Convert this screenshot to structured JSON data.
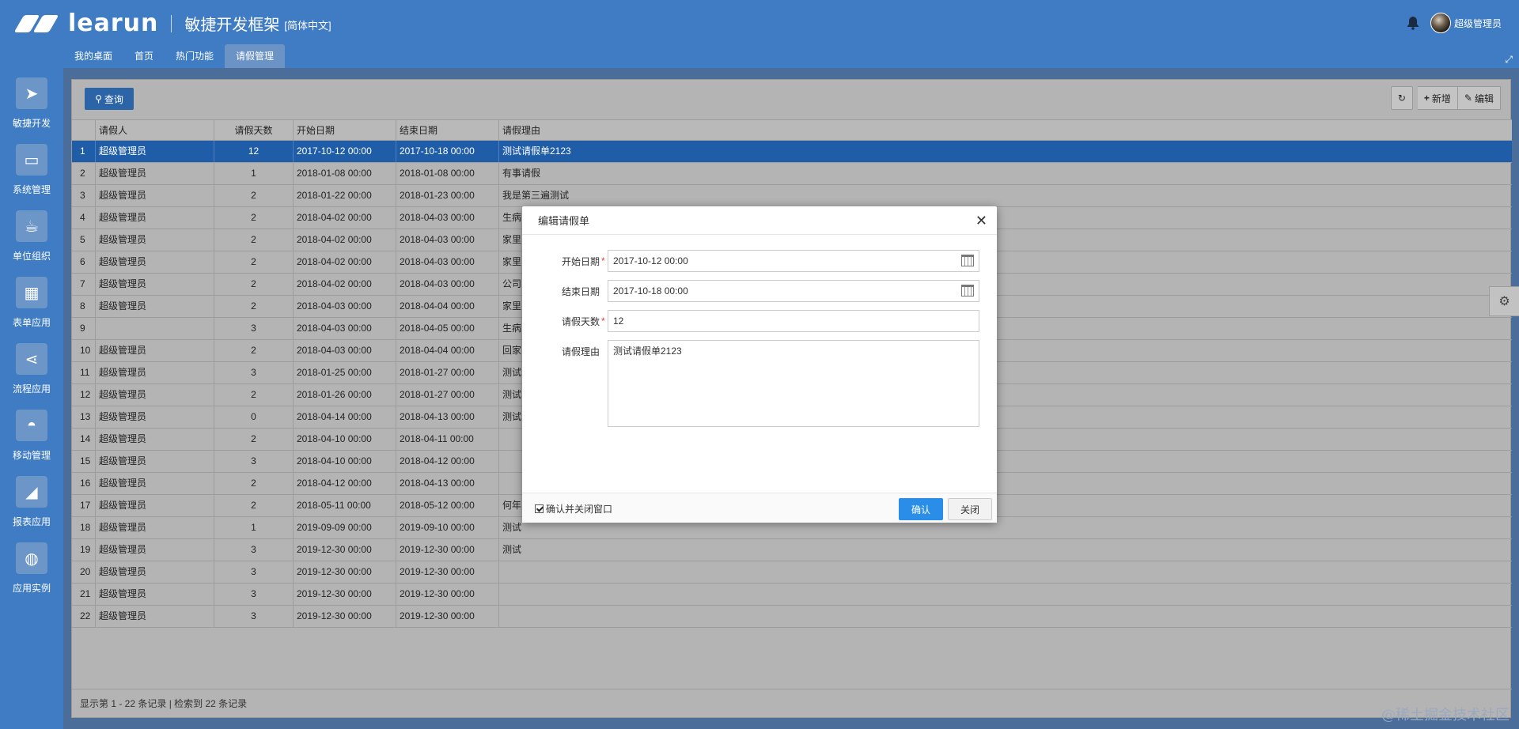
{
  "header": {
    "brand": "learun",
    "title": "敏捷开发框架",
    "lang": "[简体中文]",
    "username": "超级管理员",
    "icons": {
      "bell": "bell-icon",
      "expand": "expand-icon"
    }
  },
  "nav": {
    "tabs": [
      {
        "label": "我的桌面"
      },
      {
        "label": "首页"
      },
      {
        "label": "热门功能"
      },
      {
        "label": "请假管理"
      }
    ]
  },
  "sidebar": {
    "items": [
      {
        "label": "敏捷开发",
        "icon": "paper-plane-icon"
      },
      {
        "label": "系统管理",
        "icon": "monitor-icon"
      },
      {
        "label": "单位组织",
        "icon": "coffee-icon"
      },
      {
        "label": "表单应用",
        "icon": "table-icon"
      },
      {
        "label": "流程应用",
        "icon": "share-icon"
      },
      {
        "label": "移动管理",
        "icon": "android-icon"
      },
      {
        "label": "报表应用",
        "icon": "area-chart-icon"
      },
      {
        "label": "应用实例",
        "icon": "globe-icon"
      }
    ]
  },
  "toolbar": {
    "search_label": "查询",
    "add_label": "新增",
    "edit_label": "编辑"
  },
  "grid": {
    "columns": [
      "",
      "请假人",
      "请假天数",
      "开始日期",
      "结束日期",
      "请假理由"
    ],
    "rows": [
      [
        "1",
        "超级管理员",
        "12",
        "2017-10-12 00:00",
        "2017-10-18 00:00",
        "测试请假单2123"
      ],
      [
        "2",
        "超级管理员",
        "1",
        "2018-01-08 00:00",
        "2018-01-08 00:00",
        "有事请假"
      ],
      [
        "3",
        "超级管理员",
        "2",
        "2018-01-22 00:00",
        "2018-01-23 00:00",
        "我是第三遍测试"
      ],
      [
        "4",
        "超级管理员",
        "2",
        "2018-04-02 00:00",
        "2018-04-03 00:00",
        "生病"
      ],
      [
        "5",
        "超级管理员",
        "2",
        "2018-04-02 00:00",
        "2018-04-03 00:00",
        "家里"
      ],
      [
        "6",
        "超级管理员",
        "2",
        "2018-04-02 00:00",
        "2018-04-03 00:00",
        "家里"
      ],
      [
        "7",
        "超级管理员",
        "2",
        "2018-04-02 00:00",
        "2018-04-03 00:00",
        "公司"
      ],
      [
        "8",
        "超级管理员",
        "2",
        "2018-04-03 00:00",
        "2018-04-04 00:00",
        "家里"
      ],
      [
        "9",
        "",
        "3",
        "2018-04-03 00:00",
        "2018-04-05 00:00",
        "生病"
      ],
      [
        "10",
        "超级管理员",
        "2",
        "2018-04-03 00:00",
        "2018-04-04 00:00",
        "回家"
      ],
      [
        "11",
        "超级管理员",
        "3",
        "2018-01-25 00:00",
        "2018-01-27 00:00",
        "测试"
      ],
      [
        "12",
        "超级管理员",
        "2",
        "2018-01-26 00:00",
        "2018-01-27 00:00",
        "测试"
      ],
      [
        "13",
        "超级管理员",
        "0",
        "2018-04-14 00:00",
        "2018-04-13 00:00",
        "测试"
      ],
      [
        "14",
        "超级管理员",
        "2",
        "2018-04-10 00:00",
        "2018-04-11 00:00",
        ""
      ],
      [
        "15",
        "超级管理员",
        "3",
        "2018-04-10 00:00",
        "2018-04-12 00:00",
        ""
      ],
      [
        "16",
        "超级管理员",
        "2",
        "2018-04-12 00:00",
        "2018-04-13 00:00",
        ""
      ],
      [
        "17",
        "超级管理员",
        "2",
        "2018-05-11 00:00",
        "2018-05-12 00:00",
        "何年"
      ],
      [
        "18",
        "超级管理员",
        "1",
        "2019-09-09 00:00",
        "2019-09-10 00:00",
        "测试"
      ],
      [
        "19",
        "超级管理员",
        "3",
        "2019-12-30 00:00",
        "2019-12-30 00:00",
        "测试"
      ],
      [
        "20",
        "超级管理员",
        "3",
        "2019-12-30 00:00",
        "2019-12-30 00:00",
        ""
      ],
      [
        "21",
        "超级管理员",
        "3",
        "2019-12-30 00:00",
        "2019-12-30 00:00",
        ""
      ],
      [
        "22",
        "超级管理员",
        "3",
        "2019-12-30 00:00",
        "2019-12-30 00:00",
        ""
      ]
    ],
    "selected_row": 0,
    "footer": "显示第 1 - 22 条记录 | 检索到 22 条记录"
  },
  "modal": {
    "title": "编辑请假单",
    "start_label": "开始日期",
    "start_value": "2017-10-12 00:00",
    "end_label": "结束日期",
    "end_value": "2017-10-18 00:00",
    "days_label": "请假天数",
    "days_value": "12",
    "reason_label": "请假理由",
    "reason_value": "测试请假单2123",
    "confirm_close_label": "确认并关闭窗口",
    "ok_label": "确认",
    "cancel_label": "关闭",
    "required_mark": "*"
  },
  "watermark": "@稀土掘金技术社区",
  "colors": {
    "brand": "#3f7cc4",
    "selected_row": "#1f5da8",
    "primary_button": "#2a8ee8",
    "required": "#e53c3c"
  }
}
